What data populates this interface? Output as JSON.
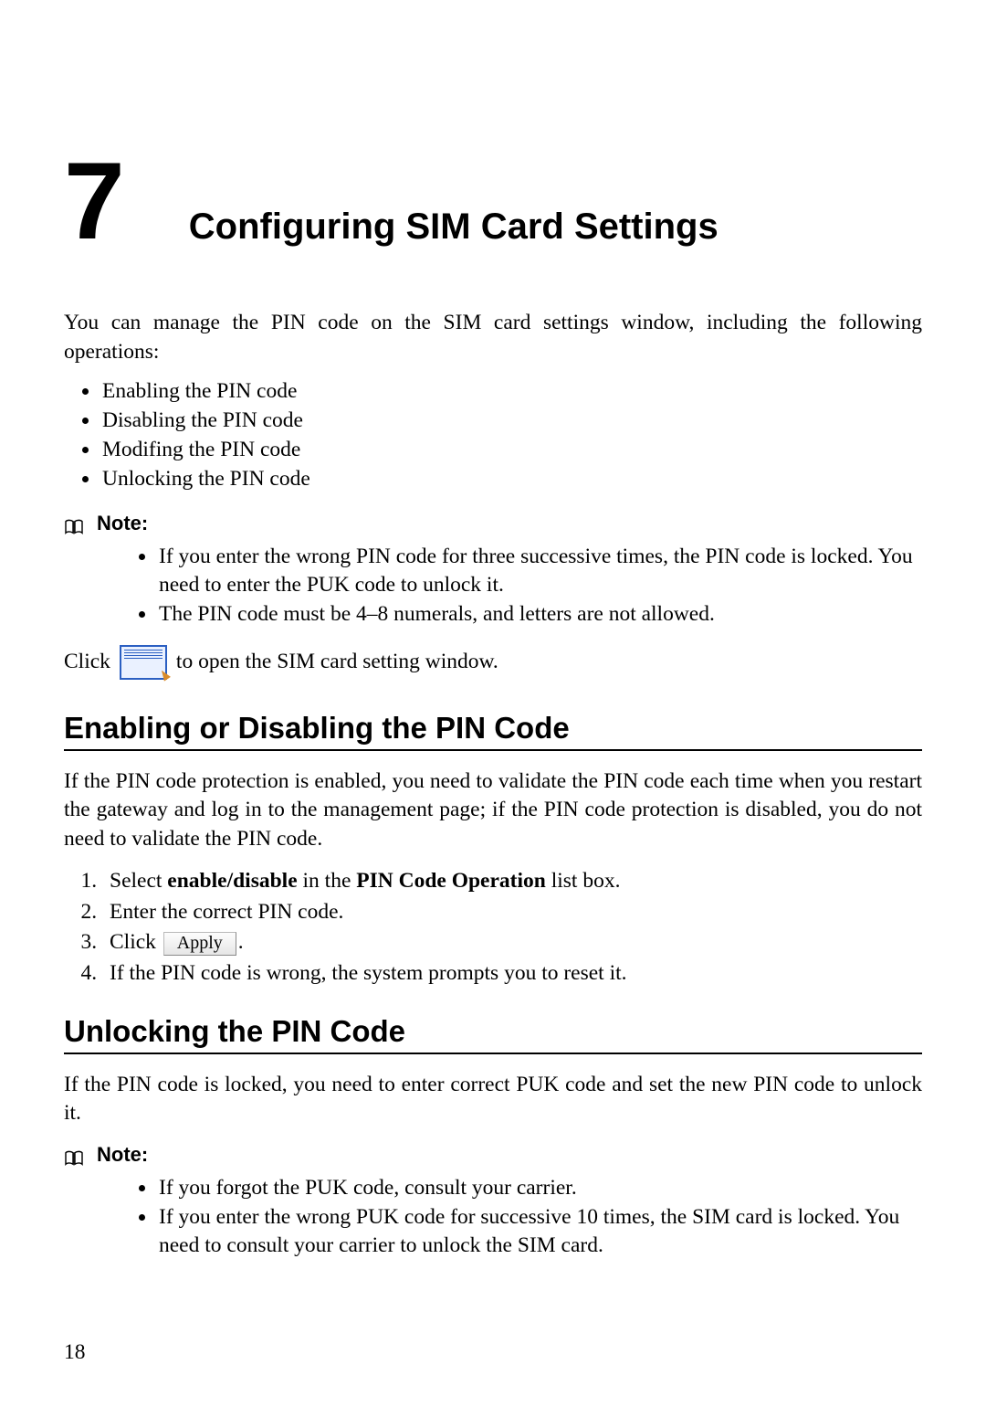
{
  "chapter": {
    "number": "7",
    "title": "Configuring SIM Card Settings"
  },
  "intro": "You can manage the PIN code on the SIM card settings window, including the following operations:",
  "operations": [
    "Enabling the PIN code",
    "Disabling the PIN code",
    "Modifing the PIN code",
    "Unlocking the PIN code"
  ],
  "note1": {
    "label": "Note:",
    "items": [
      "If you enter the wrong PIN code for three successive times, the PIN code is locked. You need to enter the PUK code to unlock it.",
      "The PIN code must be 4–8 numerals, and letters are not allowed."
    ]
  },
  "click_line": {
    "before": "Click",
    "after": "to open the SIM card setting window."
  },
  "section1": {
    "heading": "Enabling or Disabling the PIN Code",
    "para": "If the PIN code protection is enabled, you need to validate the PIN code each time when you restart the gateway and log in to the management page; if the PIN code protection is disabled, you do not need to validate the PIN code.",
    "steps": {
      "s1_a": "Select ",
      "s1_b": "enable/disable",
      "s1_c": " in the ",
      "s1_d": "PIN Code Operation",
      "s1_e": " list box.",
      "s2": "Enter the correct PIN code.",
      "s3_a": "Click ",
      "s3_btn": "Apply",
      "s3_b": ".",
      "s4": "If the PIN code is wrong, the system prompts you to reset it."
    }
  },
  "section2": {
    "heading": "Unlocking the PIN Code",
    "para": "If the PIN code is locked, you need to enter correct PUK code and set the new PIN code to unlock it."
  },
  "note2": {
    "label": "Note:",
    "items": [
      "If you forgot the PUK code, consult your carrier.",
      "If you enter the wrong PUK code for successive 10 times, the SIM card is locked. You need to consult your carrier to unlock the SIM card."
    ]
  },
  "page_number": "18"
}
